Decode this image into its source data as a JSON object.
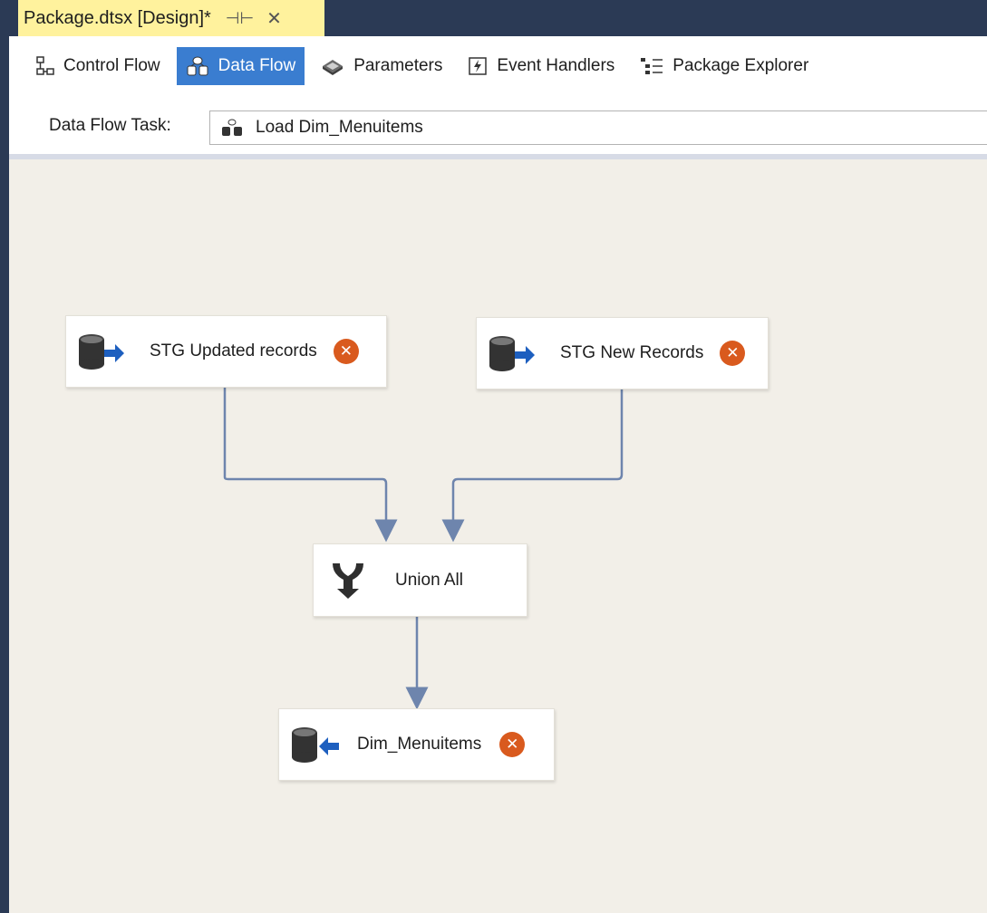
{
  "document_tab": {
    "title": "Package.dtsx [Design]*",
    "pin_icon": "pin-icon",
    "close_icon": "close-icon"
  },
  "designer_tabs": [
    {
      "label": "Control Flow",
      "icon": "control-flow-icon",
      "active": false
    },
    {
      "label": "Data Flow",
      "icon": "data-flow-icon",
      "active": true
    },
    {
      "label": "Parameters",
      "icon": "parameters-icon",
      "active": false
    },
    {
      "label": "Event Handlers",
      "icon": "event-handlers-icon",
      "active": false
    },
    {
      "label": "Package Explorer",
      "icon": "package-explorer-icon",
      "active": false
    }
  ],
  "task_selector": {
    "label": "Data Flow Task:",
    "value": "Load Dim_Menuitems",
    "icon": "data-flow-task-icon"
  },
  "components": [
    {
      "label": "STG Updated records",
      "type": "source",
      "icon": "source-icon",
      "has_error": true
    },
    {
      "label": "STG New Records",
      "type": "source",
      "icon": "source-icon",
      "has_error": true
    },
    {
      "label": "Union All",
      "type": "transform",
      "icon": "union-all-icon",
      "has_error": false
    },
    {
      "label": "Dim_Menuitems",
      "type": "destination",
      "icon": "destination-icon",
      "has_error": true
    }
  ],
  "colors": {
    "frame": "#2b3a55",
    "tab_highlight": "#fff29d",
    "active_tab": "#3a7dd0",
    "canvas": "#f2efe8",
    "connector": "#6e85ad",
    "error": "#d95a1e"
  }
}
